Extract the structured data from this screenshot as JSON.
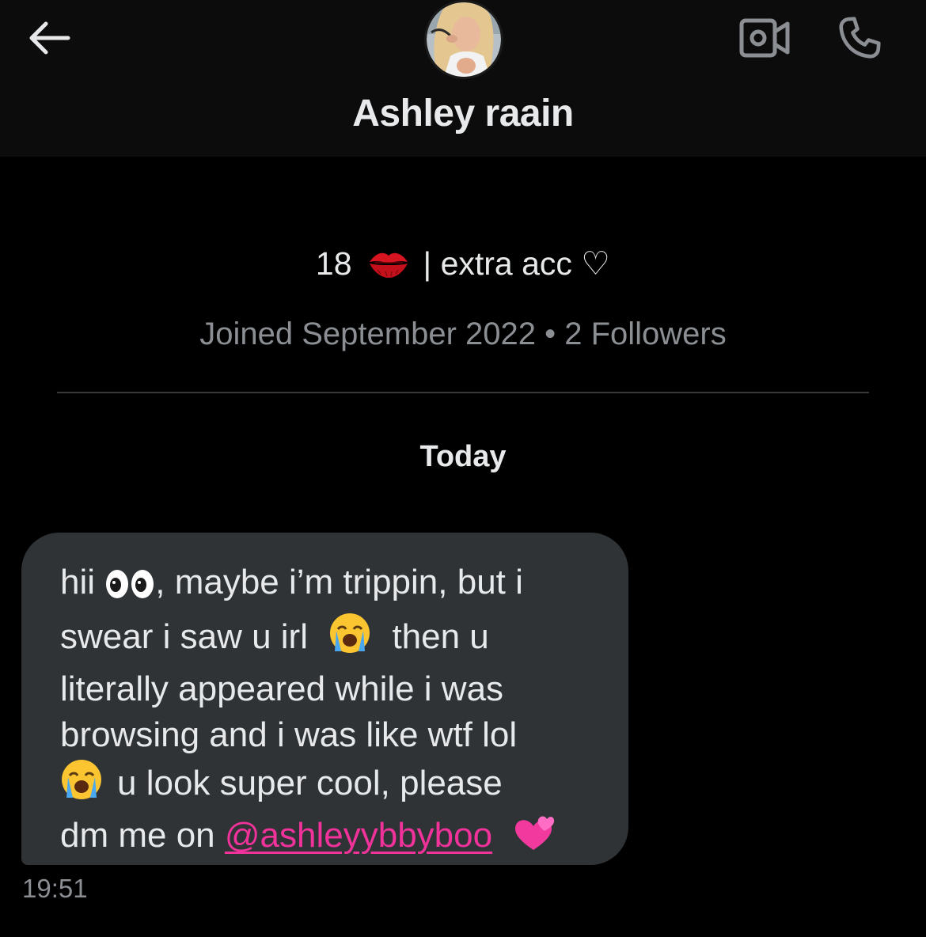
{
  "header": {
    "name": "Ashley raain",
    "back_icon": "arrow-left-icon",
    "video_icon": "video-camera-icon",
    "call_icon": "phone-icon"
  },
  "profile": {
    "bio_age": "18",
    "bio_emoji": "kiss-mark",
    "bio_text": "| extra acc ♡",
    "meta": "Joined September 2022 • 2 Followers"
  },
  "conversation": {
    "date_label": "Today",
    "message": {
      "line1_a": "hii",
      "line1_b": ", maybe i’m trippin, but i",
      "line2_a": "swear i saw u irl",
      "line2_b": "then u",
      "line3": "literally appeared while i was",
      "line4": "browsing and i was like wtf lol",
      "line5": "u look super cool, please",
      "line6_a": "dm me on",
      "mention": "@ashleyybbyboo",
      "time": "19:51"
    }
  },
  "colors": {
    "background": "#000000",
    "header_bg": "#0c0c0c",
    "bubble_bg": "#2f3336",
    "text_primary": "#e7e9ea",
    "text_secondary": "#8b8f94",
    "mention": "#f0329a"
  }
}
